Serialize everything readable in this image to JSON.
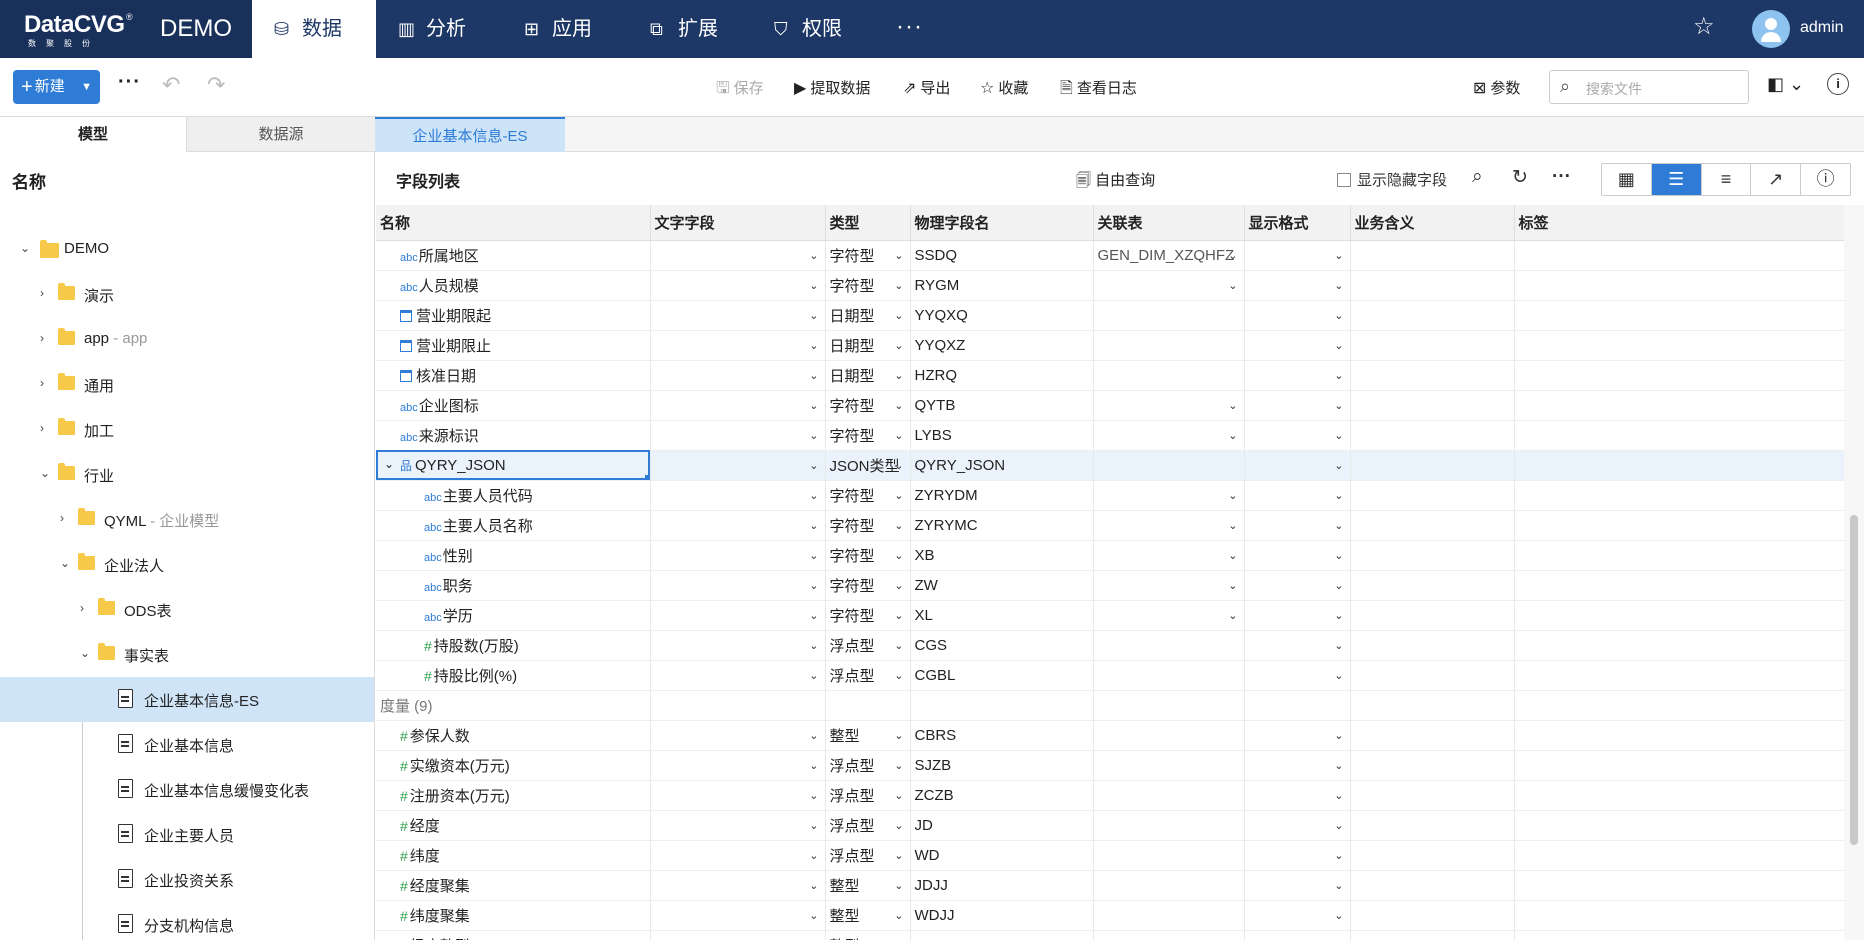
{
  "topnav": {
    "brand": "DataCVG",
    "brand_reg": "®",
    "brand_sub": "数聚股份",
    "project": "DEMO",
    "tabs": [
      {
        "label": "数据",
        "icon": "database-icon"
      },
      {
        "label": "分析",
        "icon": "bar-chart-icon"
      },
      {
        "label": "应用",
        "icon": "apps-icon"
      },
      {
        "label": "扩展",
        "icon": "extension-icon"
      },
      {
        "label": "权限",
        "icon": "shield-icon"
      }
    ],
    "more": "···",
    "user": "admin"
  },
  "toolbar": {
    "new_label": "新建",
    "save": "保存",
    "extract": "提取数据",
    "export": "导出",
    "favorite": "收藏",
    "log": "查看日志",
    "params": "参数",
    "search_placeholder": "搜索文件"
  },
  "left_tabs": [
    "模型",
    "数据源"
  ],
  "doc_tab": "企业基本信息-ES",
  "left_pane": {
    "title": "名称",
    "tree": [
      {
        "label": "DEMO",
        "extra": ""
      },
      {
        "label": "演示",
        "extra": ""
      },
      {
        "label": "app",
        "extra": " - app"
      },
      {
        "label": "通用",
        "extra": ""
      },
      {
        "label": "加工",
        "extra": ""
      },
      {
        "label": "行业",
        "extra": ""
      },
      {
        "label": "QYML",
        "extra": " - 企业模型"
      },
      {
        "label": "企业法人",
        "extra": ""
      },
      {
        "label": "ODS表",
        "extra": ""
      },
      {
        "label": "事实表",
        "extra": ""
      },
      {
        "label": "企业基本信息-ES",
        "extra": ""
      },
      {
        "label": "企业基本信息",
        "extra": ""
      },
      {
        "label": "企业基本信息缓慢变化表",
        "extra": ""
      },
      {
        "label": "企业主要人员",
        "extra": ""
      },
      {
        "label": "企业投资关系",
        "extra": ""
      },
      {
        "label": "分支机构信息",
        "extra": ""
      }
    ]
  },
  "main": {
    "title": "字段列表",
    "free_query": "自由查询",
    "show_hidden": "显示隐藏字段",
    "columns": [
      "名称",
      "文字字段",
      "类型",
      "物理字段名",
      "关联表",
      "显示格式",
      "业务含义",
      "标签"
    ],
    "rows": [
      {
        "name": "所属地区",
        "type": "字符型",
        "phys": "SSDQ",
        "rel": "GEN_DIM_XZQHFZ",
        "kind": "text"
      },
      {
        "name": "人员规模",
        "type": "字符型",
        "phys": "RYGM",
        "rel": "",
        "kind": "text"
      },
      {
        "name": "营业期限起",
        "type": "日期型",
        "phys": "YYQXQ",
        "rel": "",
        "kind": "date"
      },
      {
        "name": "营业期限止",
        "type": "日期型",
        "phys": "YYQXZ",
        "rel": "",
        "kind": "date"
      },
      {
        "name": "核准日期",
        "type": "日期型",
        "phys": "HZRQ",
        "rel": "",
        "kind": "date"
      },
      {
        "name": "企业图标",
        "type": "字符型",
        "phys": "QYTB",
        "rel": "",
        "kind": "text"
      },
      {
        "name": "来源标识",
        "type": "字符型",
        "phys": "LYBS",
        "rel": "",
        "kind": "text"
      },
      {
        "name": "QYRY_JSON",
        "type": "JSON类型",
        "phys": "QYRY_JSON",
        "rel": "",
        "kind": "json"
      },
      {
        "name": "主要人员代码",
        "type": "字符型",
        "phys": "ZYRYDM",
        "rel": "",
        "kind": "text"
      },
      {
        "name": "主要人员名称",
        "type": "字符型",
        "phys": "ZYRYMC",
        "rel": "",
        "kind": "text"
      },
      {
        "name": "性别",
        "type": "字符型",
        "phys": "XB",
        "rel": "",
        "kind": "text"
      },
      {
        "name": "职务",
        "type": "字符型",
        "phys": "ZW",
        "rel": "",
        "kind": "text"
      },
      {
        "name": "学历",
        "type": "字符型",
        "phys": "XL",
        "rel": "",
        "kind": "text"
      },
      {
        "name": "持股数(万股)",
        "type": "浮点型",
        "phys": "CGS",
        "rel": "",
        "kind": "num"
      },
      {
        "name": "持股比例(%)",
        "type": "浮点型",
        "phys": "CGBL",
        "rel": "",
        "kind": "num"
      }
    ],
    "group_label": "度量 (9)",
    "measures": [
      {
        "name": "参保人数",
        "type": "整型",
        "phys": "CBRS"
      },
      {
        "name": "实缴资本(万元)",
        "type": "浮点型",
        "phys": "SJZB"
      },
      {
        "name": "注册资本(万元)",
        "type": "浮点型",
        "phys": "ZCZB"
      },
      {
        "name": "经度",
        "type": "浮点型",
        "phys": "JD"
      },
      {
        "name": "纬度",
        "type": "浮点型",
        "phys": "WD"
      },
      {
        "name": "经度聚集",
        "type": "整型",
        "phys": "JDJJ"
      },
      {
        "name": "纬度聚集",
        "type": "整型",
        "phys": "WDJJ"
      },
      {
        "name": "经度整型",
        "type": "整型",
        "phys": "JLNG"
      }
    ]
  }
}
